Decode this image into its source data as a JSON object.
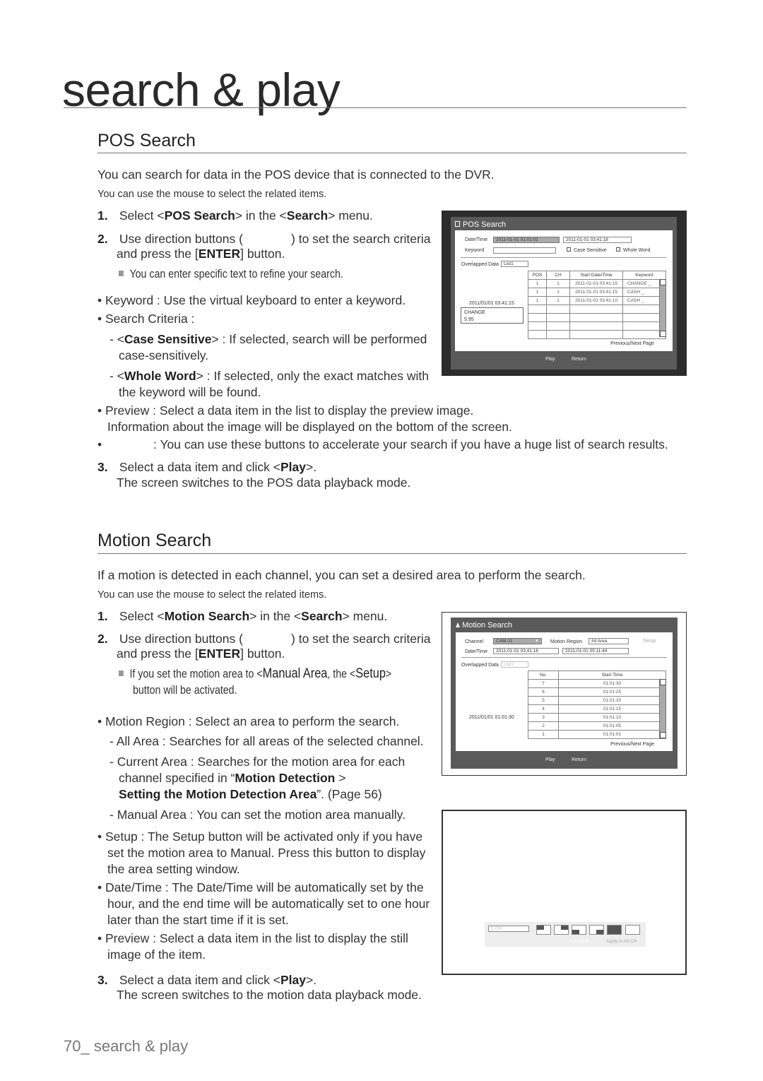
{
  "page_title": "search & play",
  "footer": {
    "page_number": "70_",
    "label": "search & play"
  },
  "pos": {
    "heading": "POS Search",
    "intro": "You can search for data in the POS device that is connected to the DVR.",
    "mouse_note": "You can use the mouse to select the related items.",
    "lines": {
      "step1": [
        {
          "t": "1.",
          "n": 1
        },
        {
          "t": " Select <"
        },
        {
          "t": "POS Search",
          "b": 1
        },
        {
          "t": "> in the <"
        },
        {
          "t": "Search",
          "b": 1
        },
        {
          "t": "> menu."
        }
      ],
      "step2a": [
        {
          "t": "2.",
          "n": 1
        },
        {
          "t": " Use direction buttons (              ) to set the search criteria"
        }
      ],
      "step2b": [
        {
          "t": "and press the ["
        },
        {
          "t": "ENTER",
          "b": 1
        },
        {
          "t": "] button."
        }
      ],
      "note": [
        {
          "t": "",
          "sq": 1
        },
        {
          "t": "You can enter specific text to refine your search."
        }
      ],
      "keyword": [
        {
          "t": "• Keyword : Use the virtual keyboard to enter a keyword."
        }
      ],
      "criteria": [
        {
          "t": "• Search Criteria :"
        }
      ],
      "case1": [
        {
          "t": "- <"
        },
        {
          "t": "Case Sensitive",
          "b": 1
        },
        {
          "t": "> : If selected, search will be performed"
        }
      ],
      "case2": [
        {
          "t": "case-sensitively."
        }
      ],
      "whole1": [
        {
          "t": "- <"
        },
        {
          "t": "Whole Word",
          "b": 1
        },
        {
          "t": "> : If selected, only the exact matches with"
        }
      ],
      "whole2": [
        {
          "t": "the keyword will be found."
        }
      ],
      "preview1": [
        {
          "t": "• Preview : Select a data item in the list to display the preview image."
        }
      ],
      "preview2": [
        {
          "t": "Information about the image will be displayed on the bottom of the screen."
        }
      ],
      "page_btns": [
        {
          "t": "•               : You can use these buttons to accelerate your search if you have a huge list of search results."
        }
      ],
      "step3": [
        {
          "t": "3.",
          "n": 1
        },
        {
          "t": " Select a data item and click <"
        },
        {
          "t": "Play",
          "b": 1
        },
        {
          "t": ">."
        }
      ],
      "step3b": [
        {
          "t": "The screen switches to the POS data playback mode."
        }
      ]
    },
    "screen": {
      "title": "POS Search",
      "datetime_label": "Date/Time",
      "start": "2011-01-01 01:01:01",
      "end": "2011-01-01  03:41:18",
      "keyword_label": "Keyword",
      "keyword_value": "",
      "case_sensitive": "Case Sensitive",
      "whole_word": "Whole Word",
      "overlapped_label": "Overlapped Data",
      "overlapped_value": "List1",
      "columns": [
        "POS",
        "CH",
        "Start Date/Time",
        "Keyword"
      ],
      "rows": [
        [
          "1",
          "1",
          "2011-01-01 03:41:15",
          "CHANGE _"
        ],
        [
          "1",
          "1",
          "2011-01-01 03:41:15",
          "CASH _"
        ],
        [
          "1",
          "1",
          "2011-01-01 03:41:10",
          "CASH _"
        ]
      ],
      "preview_time": "2011/01/01  03:41:15",
      "preview_text1": "CHANGE",
      "preview_text2": "5.95",
      "prev_next": "Previous/Next Page",
      "play": "Play",
      "return": "Return"
    }
  },
  "motion": {
    "heading": "Motion Search",
    "intro": "If a motion is detected in each channel, you can set a desired area to perform the search.",
    "mouse_note": "You can use the mouse to select the related items.",
    "lines": {
      "step1": [
        {
          "t": "1.",
          "n": 1
        },
        {
          "t": " Select <"
        },
        {
          "t": "Motion Search",
          "b": 1
        },
        {
          "t": "> in the <"
        },
        {
          "t": "Search",
          "b": 1
        },
        {
          "t": "> menu."
        }
      ],
      "step2a": [
        {
          "t": "2.",
          "n": 1
        },
        {
          "t": " Use direction buttons (              ) to set the search criteria"
        }
      ],
      "step2b": [
        {
          "t": "and press the ["
        },
        {
          "t": "ENTER",
          "b": 1
        },
        {
          "t": "] button."
        }
      ],
      "note1": [
        {
          "t": "",
          "sq": 1
        },
        {
          "t": "If you set the motion area to <"
        },
        {
          "t": "Manual Area",
          "w": 1
        },
        {
          "t": ", the <"
        },
        {
          "t": "Setup",
          "w": 1
        },
        {
          "t": ">"
        }
      ],
      "note2": [
        {
          "t": "button will be activated."
        }
      ],
      "region": [
        {
          "t": "• Motion Region : Select an area to perform the search."
        }
      ],
      "all": [
        {
          "t": "- All Area : Searches for all areas of the selected channel."
        }
      ],
      "current1": [
        {
          "t": "- Current Area : Searches for the motion area for each"
        }
      ],
      "current2": [
        {
          "t": "channel specified in “"
        },
        {
          "t": "Motion Detection",
          "b": 1
        },
        {
          "t": " >"
        }
      ],
      "current3": [
        {
          "t": "Setting the Motion Detection Area",
          "b": 1
        },
        {
          "t": "”. (Page 56)"
        }
      ],
      "manual": [
        {
          "t": "- Manual Area : You can set the motion area manually."
        }
      ],
      "setup1": [
        {
          "t": "• Setup : The Setup button will be activated only if you have"
        }
      ],
      "setup2": [
        {
          "t": "set the motion area to Manual. Press this button to display"
        }
      ],
      "setup3": [
        {
          "t": "the area setting window."
        }
      ],
      "date1": [
        {
          "t": "• Date/Time : The Date/Time will be automatically set by the"
        }
      ],
      "date2": [
        {
          "t": "hour, and the end time will be automatically set to one hour"
        }
      ],
      "date3": [
        {
          "t": "later than the start time if it is set."
        }
      ],
      "prev1": [
        {
          "t": "• Preview : Select a data item in the list to display the still"
        }
      ],
      "prev2": [
        {
          "t": "image of the item."
        }
      ],
      "step3": [
        {
          "t": "3.",
          "n": 1
        },
        {
          "t": " Select a data item and click <"
        },
        {
          "t": "Play",
          "b": 1
        },
        {
          "t": ">."
        }
      ],
      "step3b": [
        {
          "t": "The screen switches to the motion data playback mode."
        }
      ]
    },
    "screen": {
      "title": "Motion Search",
      "channel_label": "Channel",
      "channel_value": "CAM 01",
      "region_label": "Motion Region",
      "region_value": "All Area",
      "setup": "Setup",
      "datetime_label": "Date/Time",
      "start": "2011-01-01  03:41:18",
      "end": "2011-01-01  05:11:44",
      "overlapped_label": "Overlapped Data",
      "overlapped_value": "List1",
      "columns": [
        "No.",
        "Start Time"
      ],
      "rows": [
        [
          "7",
          "01:01:30"
        ],
        [
          "6",
          "01:01:25"
        ],
        [
          "5",
          "01:01:20"
        ],
        [
          "4",
          "01:01:15"
        ],
        [
          "3",
          "01:01:10"
        ],
        [
          "2",
          "01:01:05"
        ],
        [
          "1",
          "01:01:01"
        ]
      ],
      "preview_time": "2011/01/01  01:01:30",
      "prev_next": "Previous/Next Page",
      "play": "Play",
      "return": "Return"
    },
    "area_screen": {
      "channel_value": "1 CH",
      "individual": "Individual",
      "apply_all": "Apply to All CH"
    }
  }
}
